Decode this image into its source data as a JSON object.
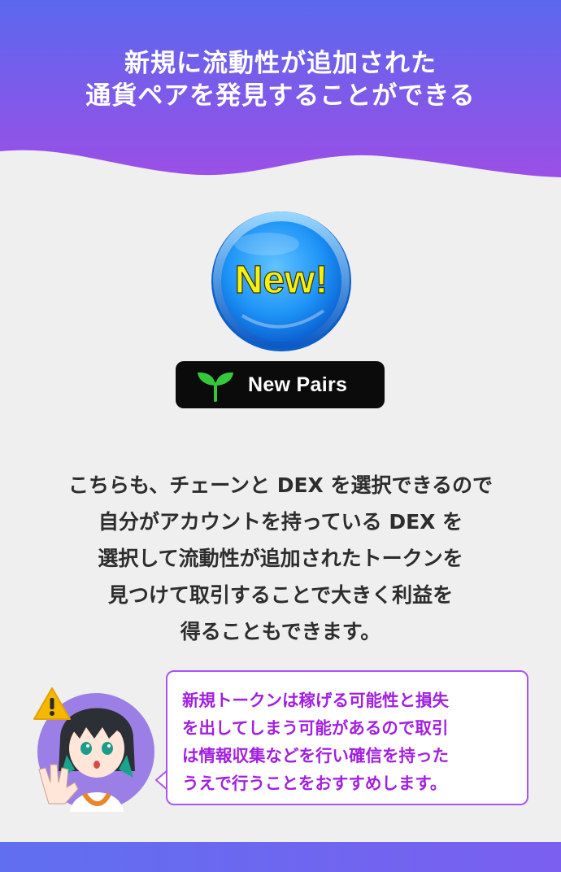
{
  "header": {
    "title_line1": "新規に流動性が追加された",
    "title_line2": "通貨ペアを発見することができる",
    "gradient_top": "#5b68ee",
    "gradient_bottom": "#9b4fe6"
  },
  "badge": {
    "text": "New!",
    "circle_color": "#1a8ff5",
    "text_color": "#f4f20e"
  },
  "pill": {
    "icon": "sprout-icon",
    "label": "New Pairs"
  },
  "body": {
    "lines": [
      "こちらも、チェーンと DEX を選択できるので",
      "自分がアカウントを持っている DEX を",
      "選択して流動性が追加されたトークンを",
      "見つけて取引することで大きく利益を",
      "得ることもできます。"
    ]
  },
  "warning": {
    "icon": "warning-icon",
    "avatar": "character-avatar",
    "lines": [
      "新規トークンは稼げる可能性と損失",
      "を出してしまう可能があるので取引",
      "は情報収集などを行い確信を持った",
      "うえで行うことをおすすめします。"
    ],
    "text_color": "#a21fe0",
    "border_color": "#a855f7"
  },
  "footer": {
    "color": "#6a64ef"
  }
}
